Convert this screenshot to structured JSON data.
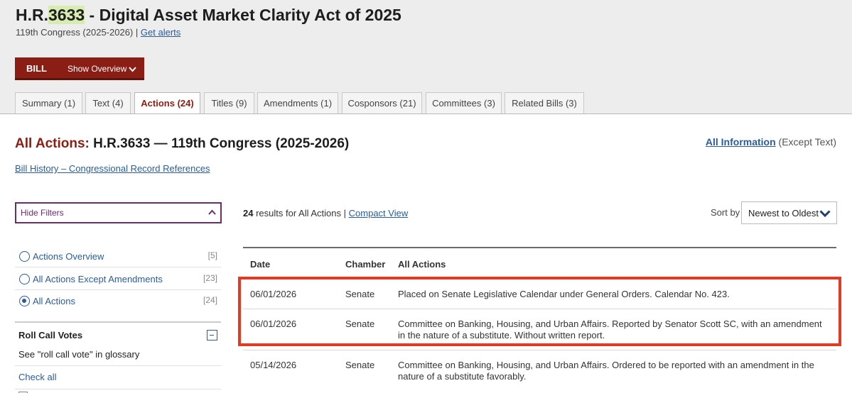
{
  "bill": {
    "title_prefix": "H.R.",
    "title_number": "3633",
    "title_rest": " - Digital Asset Market Clarity Act of 2025",
    "congress": "119th Congress (2025-2026)",
    "separator": "|",
    "get_alerts": "Get alerts"
  },
  "billbar": {
    "label": "BILL",
    "show_overview": "Show Overview"
  },
  "tabs": [
    {
      "label": "Summary (1)",
      "active": false
    },
    {
      "label": "Text (4)",
      "active": false
    },
    {
      "label": "Actions (24)",
      "active": true
    },
    {
      "label": "Titles (9)",
      "active": false
    },
    {
      "label": "Amendments (1)",
      "active": false
    },
    {
      "label": "Cosponsors (21)",
      "active": false
    },
    {
      "label": "Committees (3)",
      "active": false
    },
    {
      "label": "Related Bills (3)",
      "active": false
    }
  ],
  "heading": {
    "prefix": "All Actions:",
    "rest": " H.R.3633 — 119th Congress (2025-2026)",
    "all_information": "All Information",
    "except_text": " (Except Text)",
    "history_link": "Bill History – Congressional Record References"
  },
  "filters": {
    "hide_filters": "Hide Filters",
    "items": [
      {
        "label": "Actions Overview",
        "count": "[5]",
        "selected": false
      },
      {
        "label": "All Actions Except Amendments",
        "count": "[23]",
        "selected": false
      },
      {
        "label": "All Actions",
        "count": "[24]",
        "selected": true
      }
    ],
    "roll_call": {
      "heading": "Roll Call Votes",
      "glossary": "See \"roll call vote\" in glossary",
      "check_all": "Check all"
    }
  },
  "results": {
    "count": "24",
    "text": " results for All Actions ",
    "separator": "| ",
    "compact_view": "Compact View",
    "sort_label": "Sort by",
    "sort_value": "Newest to Oldest"
  },
  "table": {
    "headers": [
      "Date",
      "Chamber",
      "All Actions"
    ],
    "rows": [
      {
        "date": "06/01/2026",
        "chamber": "Senate",
        "action": "Placed on Senate Legislative Calendar under General Orders. Calendar No. 423."
      },
      {
        "date": "06/01/2026",
        "chamber": "Senate",
        "action": "Committee on Banking, Housing, and Urban Affairs. Reported by Senator Scott SC, with an amendment in the nature of a substitute. Without written report."
      },
      {
        "date": "05/14/2026",
        "chamber": "Senate",
        "action": "Committee on Banking, Housing, and Urban Affairs. Ordered to be reported with an amendment in the nature of a substitute favorably."
      }
    ]
  },
  "colors": {
    "brand_red": "#8b1e14",
    "link_blue": "#2a5c9e",
    "filter_purple": "#6b2d6b",
    "highlight_box": "#e33a24",
    "number_highlight": "#d6ecb0"
  }
}
